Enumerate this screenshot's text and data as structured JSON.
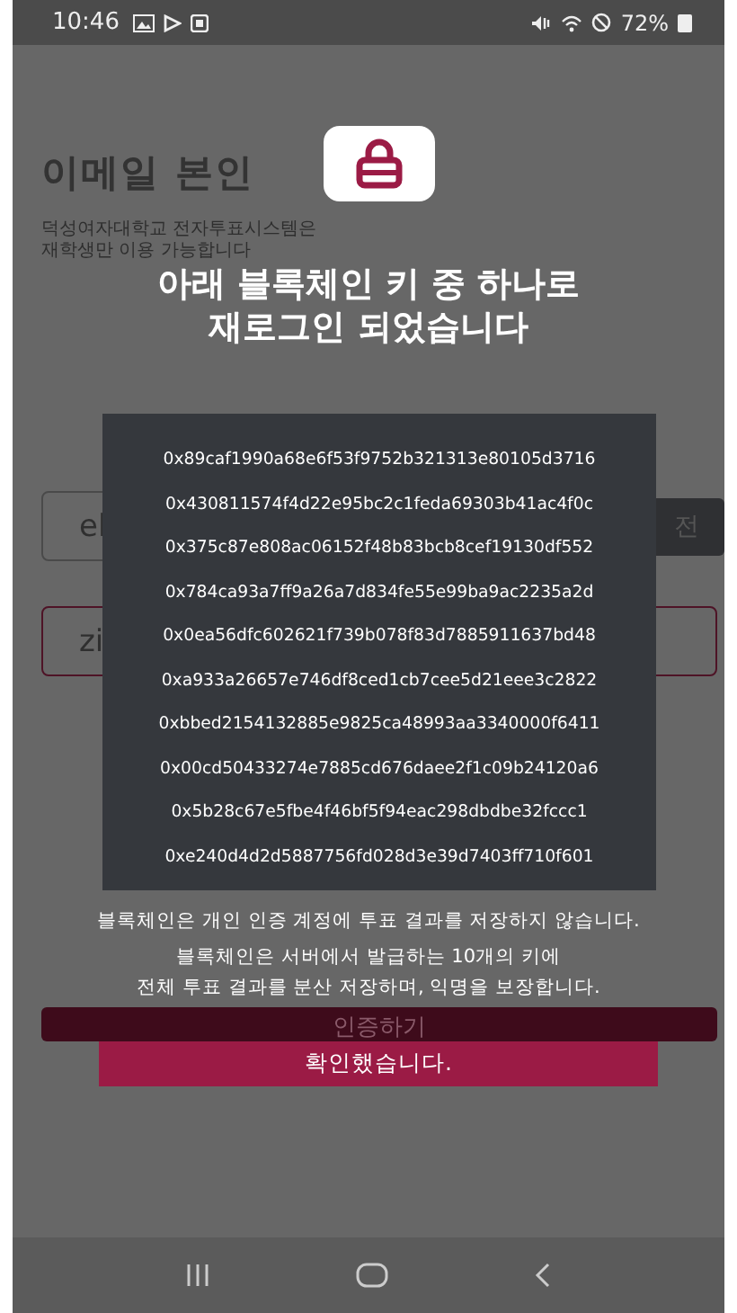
{
  "status_bar": {
    "time": "10:46",
    "battery": "72%"
  },
  "background_form": {
    "title": "이메일 본인",
    "subtitle_lines": [
      "덕성여자대학교 전자투표시스템은",
      "재학생만 이용 가능합니다"
    ],
    "email_field": {
      "value": "el"
    },
    "send_button": "전",
    "code_field": {
      "value": "zi"
    },
    "submit_button": "인증하기"
  },
  "dialog": {
    "title_lines": [
      "아래 블록체인 키 중 하나로",
      "재로그인 되었습니다"
    ],
    "keys": [
      "0x89caf1990a68e6f53f9752b321313e80105d3716",
      "0x430811574f4d22e95bc2c1feda69303b41ac4f0c",
      "0x375c87e808ac06152f48b83bcb8cef19130df552",
      "0x784ca93a7ff9a26a7d834fe55e99ba9ac2235a2d",
      "0x0ea56dfc602621f739b078f83d7885911637bd48",
      "0xa933a26657e746df8ced1cb7cee5d21eee3c2822",
      "0xbbed2154132885e9825ca48993aa3340000f6411",
      "0x00cd50433274e7885cd676daee2f1c09b24120a6",
      "0x5b28c67e5fbe4f46bf5f94eac298dbdbe32fccc1",
      "0xe240d4d2d5887756fd028d3e39d7403ff710f601"
    ],
    "notes": [
      "블록체인은 개인 인증 계정에 투표 결과를 저장하지 않습니다.",
      "블록체인은 서버에서 발급하는 10개의 키에",
      "전체 투표 결과를 분산 저장하며, 익명을 보장합니다."
    ],
    "confirm_button": "확인했습니다."
  }
}
